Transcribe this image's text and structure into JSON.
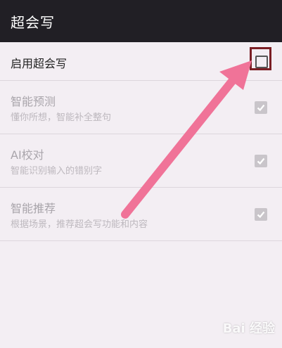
{
  "app_bar": {
    "title": "超会写"
  },
  "settings": [
    {
      "label": "启用超会写",
      "subtitle": "",
      "checked": false,
      "enabled": true
    },
    {
      "label": "智能预测",
      "subtitle": "懂你所想，智能补全整句",
      "checked": true,
      "enabled": false
    },
    {
      "label": "AI校对",
      "subtitle": "智能识别输入的错别字",
      "checked": true,
      "enabled": false
    },
    {
      "label": "智能推荐",
      "subtitle": "根据场景，推荐超会写功能和内容",
      "checked": true,
      "enabled": false
    }
  ],
  "annotation": {
    "arrow_color": "#f07398",
    "box_color": "#7a1e24"
  },
  "watermark": {
    "text": "Bai 经验"
  }
}
